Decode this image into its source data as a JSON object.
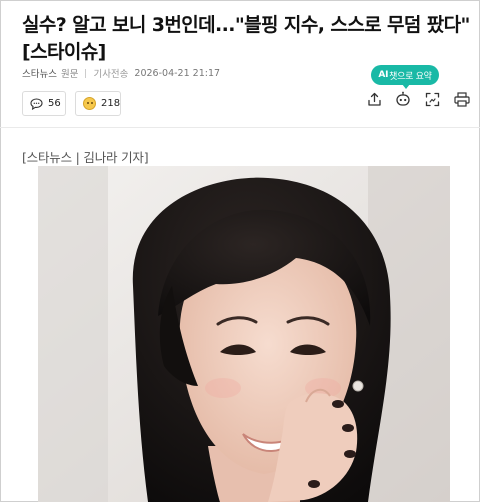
{
  "article": {
    "headline": "실수? 알고 보니 3번인데...\"블핑 지수, 스스로 무덤 팠다\" [스타이슈]",
    "press_name": "스타뉴스",
    "original_link": "원문",
    "date_label": "기사전송",
    "date": "2026-04-21 21:17",
    "byline": "[스타뉴스 | 김나라 기자]"
  },
  "actions": {
    "comment_count": "56",
    "reaction_count": "218",
    "ai_summary_prefix": "AI",
    "ai_summary_label": "챗으로 요약"
  },
  "icons": [
    "speech-bubble-icon",
    "reaction-face-icon",
    "share-icon",
    "ai-bot-icon",
    "screen-capture-icon",
    "print-icon"
  ],
  "colors": {
    "ai_badge": "#19b9a6",
    "text": "#111111",
    "muted": "#888888"
  },
  "photo": {
    "description_visible": false
  }
}
